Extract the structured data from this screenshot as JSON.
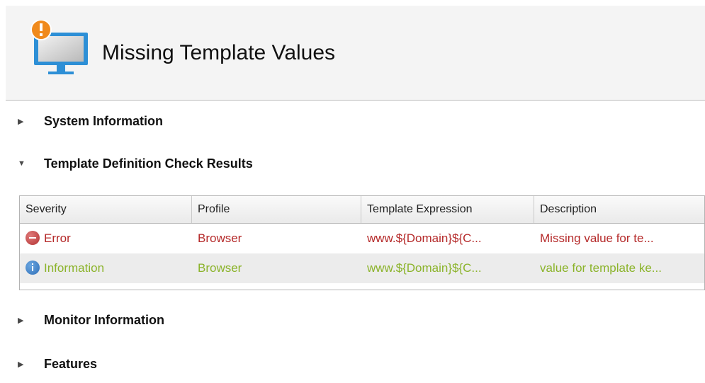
{
  "header": {
    "title": "Missing Template Values",
    "icon": "monitor-warning-icon"
  },
  "sections": {
    "system_information": {
      "label": "System Information",
      "expanded": false
    },
    "template_check": {
      "label": "Template Definition Check Results",
      "expanded": true
    },
    "monitor_information": {
      "label": "Monitor Information",
      "expanded": false
    },
    "features": {
      "label": "Features",
      "expanded": false
    }
  },
  "table": {
    "columns": [
      "Severity",
      "Profile",
      "Template Expression",
      "Description"
    ],
    "rows": [
      {
        "severity": "Error",
        "severity_icon": "error-icon",
        "profile": "Browser",
        "template_expression": "www.${Domain}${C...",
        "description": "Missing value for te...",
        "color": "#b52a2a"
      },
      {
        "severity": "Information",
        "severity_icon": "info-icon",
        "profile": "Browser",
        "template_expression": "www.${Domain}${C...",
        "description": "value for template ke...",
        "color": "#8bb32a"
      }
    ]
  },
  "colors": {
    "error_text": "#b52a2a",
    "info_text": "#8bb32a",
    "header_bg": "#f4f4f4"
  }
}
